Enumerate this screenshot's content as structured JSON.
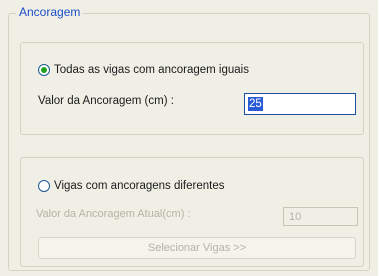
{
  "group": {
    "title": "Ancoragem"
  },
  "option_equal": {
    "label": "Todas as vigas com ancoragem iguais",
    "selected": true,
    "value_label": "Valor da Ancoragem (cm) :",
    "value": "25"
  },
  "option_different": {
    "label": "Vigas com ancoragens diferentes",
    "selected": false,
    "value_label": "Valor da Ancoragem Atual(cm) :",
    "value": "10",
    "button_label": "Selecionar Vigas >>"
  },
  "colors": {
    "title_blue": "#1c4fc8",
    "selection_blue": "#2a5bd7",
    "radio_green": "#23a21e",
    "disabled_text": "#b6b3a6",
    "background": "#f0efe6"
  }
}
